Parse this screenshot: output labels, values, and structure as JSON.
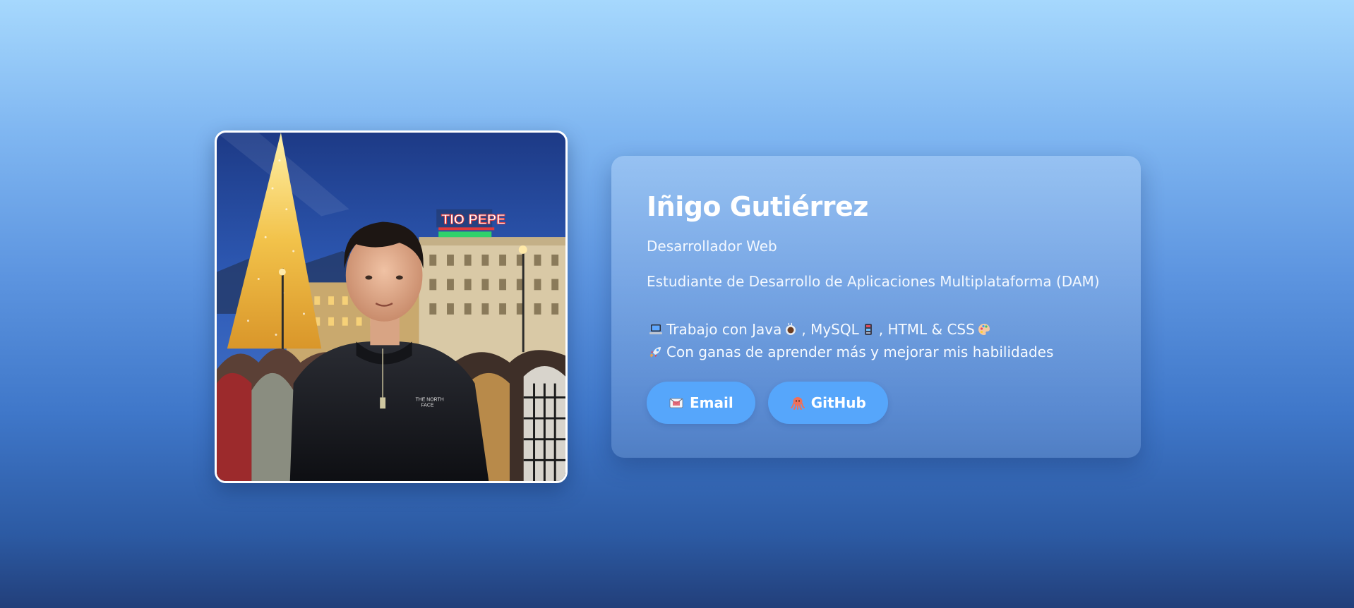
{
  "profile": {
    "photo_icon": "profile-photo",
    "name": "Iñigo Gutiérrez",
    "role": "Desarrollador Web",
    "study": "Estudiante de Desarrollo de Aplicaciones Multiplataforma (DAM)",
    "skills": {
      "icon": "laptop-icon",
      "prefix": "Trabajo con Java",
      "java_icon": "coffee-icon",
      "mysql": ", MySQL",
      "mysql_icon": "database-icon",
      "web": ", HTML & CSS",
      "web_icon": "palette-icon"
    },
    "motivation": {
      "icon": "rocket-icon",
      "text": "Con ganas de aprender más y mejorar mis habilidades"
    }
  },
  "actions": {
    "email": {
      "label": "Email",
      "icon": "email-icon"
    },
    "github": {
      "label": "GitHub",
      "icon": "octopus-icon"
    }
  },
  "colors": {
    "bg_top": "#a6d8fd",
    "bg_bottom": "#223f7a",
    "button": "#56a6fb",
    "text": "#ffffff"
  }
}
